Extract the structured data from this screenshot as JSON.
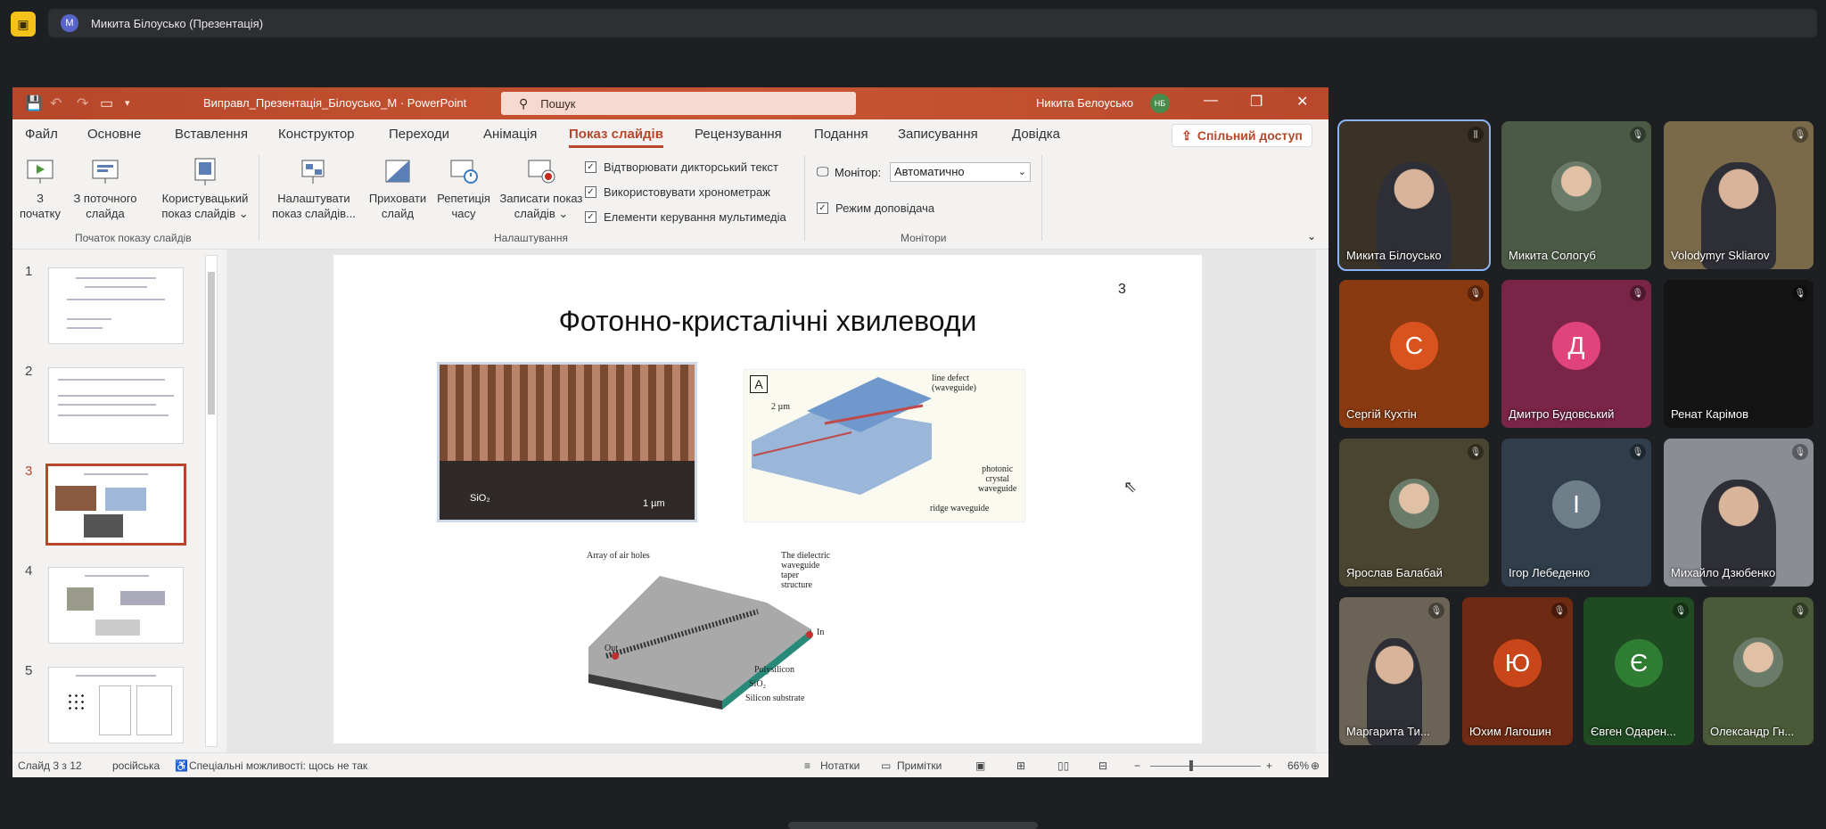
{
  "meet": {
    "presenter_initial": "М",
    "presenter_label": "Микита Білоусько (Презентація)"
  },
  "ppt": {
    "doc_title": "Виправл_Презентація_Білоусько_М  ·  PowerPoint",
    "search_placeholder": "Пошук",
    "user_name": "Никита Белоусько",
    "user_initials": "НБ",
    "tabs": [
      "Файл",
      "Основне",
      "Вставлення",
      "Конструктор",
      "Переходи",
      "Анімація",
      "Показ слайдів",
      "Рецензування",
      "Подання",
      "Записування",
      "Довідка"
    ],
    "share_label": "Спільний доступ",
    "ribbon": {
      "from_start": "З\nпочатку",
      "from_current": "З поточного\nслайда",
      "custom_show": "Користувацький\nпоказ слайдів ⌄",
      "group_start": "Початок показу слайдів",
      "setup_show": "Налаштувати\nпоказ слайдів...",
      "hide_slide": "Приховати\nслайд",
      "rehearse": "Репетиція\nчасу",
      "record": "Записати показ\nслайдів ⌄",
      "chk_narration": "Відтворювати дикторський текст",
      "chk_timings": "Використовувати хронометраж",
      "chk_media": "Елементи керування мультимедіа",
      "group_setup": "Налаштування",
      "monitor_label": "Монітор:",
      "monitor_value": "Автоматично",
      "presenter_view": "Режим доповідача",
      "group_monitors": "Монітори"
    },
    "thumb_numbers": [
      "1",
      "2",
      "3",
      "4",
      "5"
    ],
    "slide": {
      "number": "3",
      "title": "Фотонно-кристалічні хвилеводи",
      "img1_labels": [
        "SiO₂",
        "1 µm"
      ],
      "img2_labels": [
        "A",
        "2 µm",
        "line defect\n(waveguide)",
        "photonic\ncrystal\nwaveguide",
        "ridge waveguide"
      ],
      "img3_labels": [
        "Array of air holes",
        "The dielectric\nwaveguide taper\nstructure",
        "Polysilicon",
        "SiO₂",
        "Silicon substrate",
        "Out",
        "In"
      ]
    },
    "status": {
      "slide_info": "Слайд 3 з 12",
      "language": "російська",
      "accessibility": "Спеціальні можливості: щось не так",
      "notes": "Нотатки",
      "comments": "Примітки",
      "zoom": "66%"
    }
  },
  "participants": [
    {
      "name": "Микита Білоусько",
      "kind": "video",
      "bg": "#3a3226"
    },
    {
      "name": "Микита Сологуб",
      "kind": "photo",
      "bg": "#4b5a45"
    },
    {
      "name": "Volodymyr Skliarov",
      "kind": "video",
      "bg": "#7a6a4a"
    },
    {
      "name": "Сергій Кухтін",
      "kind": "letter",
      "letter": "С",
      "bg": "#8a3a10",
      "color": "#d9531e"
    },
    {
      "name": "Дмитро Будовський",
      "kind": "letter",
      "letter": "Д",
      "bg": "#7a2448",
      "color": "#e0447a"
    },
    {
      "name": "Ренат Карімов",
      "kind": "blank",
      "bg": "#141414"
    },
    {
      "name": "Ярослав Балабай",
      "kind": "photo",
      "bg": "#4a4530"
    },
    {
      "name": "Ігор Лебеденко",
      "kind": "letter",
      "letter": "І",
      "bg": "#2f3e4a",
      "color": "#6f7f8a"
    },
    {
      "name": "Михайло Дзюбенко",
      "kind": "video",
      "bg": "#8a8d94"
    },
    {
      "name": "Маргарита Ти...",
      "kind": "video",
      "bg": "#6b6356"
    },
    {
      "name": "Юхим Лагошин",
      "kind": "letter",
      "letter": "Ю",
      "bg": "#6e2a12",
      "color": "#c8461a"
    },
    {
      "name": "Євген Одарен...",
      "kind": "letter",
      "letter": "Є",
      "bg": "#1f4a22",
      "color": "#2e7d32"
    },
    {
      "name": "Олександр Гн...",
      "kind": "photo",
      "bg": "#4a5a38"
    }
  ]
}
